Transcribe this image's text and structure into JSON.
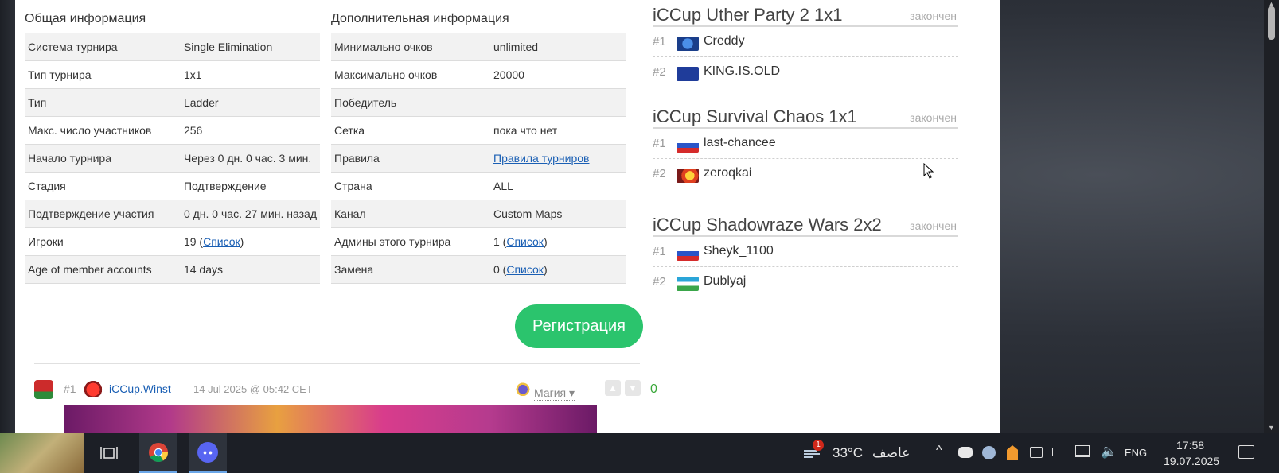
{
  "general": {
    "title": "Общая информация",
    "rows": [
      {
        "key": "Система турнира",
        "value": "Single Elimination"
      },
      {
        "key": "Тип турнира",
        "value": "1x1"
      },
      {
        "key": "Тип",
        "value": "Ladder"
      },
      {
        "key": "Макс. число участников",
        "value": "256"
      },
      {
        "key": "Начало турнира",
        "value": "Через 0 дн. 0 час. 3 мин."
      },
      {
        "key": "Стадия",
        "value": "Подтверждение"
      },
      {
        "key": "Подтверждение участия",
        "value": "0 дн. 0 час. 27 мин. назад"
      },
      {
        "key": "Игроки",
        "value_prefix": "19 (",
        "link": "Список",
        "value_suffix": ")"
      },
      {
        "key": "Age of member accounts",
        "value": "14 days"
      }
    ]
  },
  "additional": {
    "title": "Дополнительная информация",
    "rows": [
      {
        "key": "Минимально очков",
        "value": "unlimited"
      },
      {
        "key": "Максимально очков",
        "value": "20000"
      },
      {
        "key": "Победитель",
        "value": ""
      },
      {
        "key": "Сетка",
        "value": "пока что нет"
      },
      {
        "key": "Правила",
        "link": "Правила турниров"
      },
      {
        "key": "Страна",
        "value": "ALL"
      },
      {
        "key": "Канал",
        "value": "Custom Maps"
      },
      {
        "key": "Админы этого турнира",
        "value_prefix": "1 (",
        "link": "Список",
        "value_suffix": ")"
      },
      {
        "key": "Замена",
        "value_prefix": "0 (",
        "link": "Список",
        "value_suffix": ")"
      }
    ]
  },
  "register_button": "Регистрация",
  "post": {
    "number": "#1",
    "user": "iCCup.Winst",
    "date": "14 Jul 2025 @ 05:42 CET",
    "race": "Магия ▾",
    "score": "0"
  },
  "tournaments": [
    {
      "name": "iCCup Uther Party 2 1x1",
      "status": "закончен",
      "players": [
        {
          "rank": "#1",
          "name": "Creddy",
          "flag": "blue-flag-icon"
        },
        {
          "rank": "#2",
          "name": "KING.IS.OLD",
          "flag": "eu-flag-icon"
        }
      ]
    },
    {
      "name": "iCCup Survival Chaos 1x1",
      "status": "закончен",
      "players": [
        {
          "rank": "#1",
          "name": "last-chancee",
          "flag": "ru-flag-icon"
        },
        {
          "rank": "#2",
          "name": "zeroqkai",
          "flag": "custom-flag-icon"
        }
      ]
    },
    {
      "name": "iCCup Shadowraze Wars 2x2",
      "status": "закончен",
      "players": [
        {
          "rank": "#1",
          "name": "Sheyk_1100",
          "flag": "ru-flag-icon"
        },
        {
          "rank": "#2",
          "name": "Dublyaj",
          "flag": "uz-flag-icon"
        }
      ]
    }
  ],
  "taskbar": {
    "weather_temp": "33°C",
    "weather_text": "عاصف",
    "weather_badge": "1",
    "lang": "ENG",
    "time": "17:58",
    "date": "19.07.2025"
  }
}
